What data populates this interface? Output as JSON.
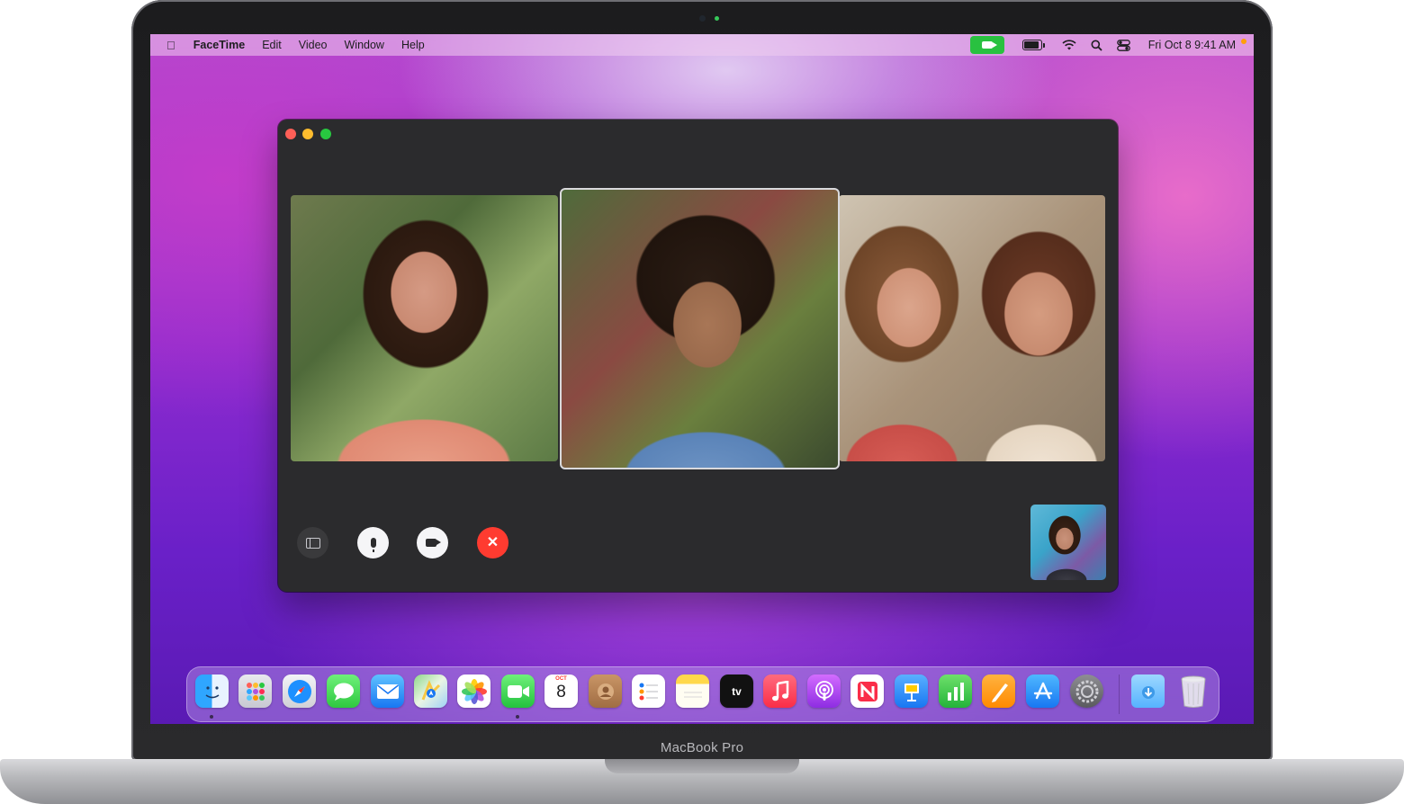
{
  "menubar": {
    "apple_glyph": "",
    "app_name": "FaceTime",
    "menus": [
      "Edit",
      "Video",
      "Window",
      "Help"
    ],
    "clock": "Fri Oct 8  9:41 AM",
    "status_icons": [
      "facetime-recording-icon",
      "battery-icon",
      "wifi-icon",
      "spotlight-icon",
      "control-center-icon"
    ]
  },
  "facetime": {
    "participants": [
      "participant-1",
      "participant-2",
      "participant-3"
    ],
    "controls": {
      "sidebar": "sidebar-icon",
      "mic": "microphone-icon",
      "video": "video-icon",
      "end": "✕"
    }
  },
  "dock": {
    "calendar_month": "OCT",
    "calendar_day": "8",
    "tv_label": "tv",
    "apps": [
      "Finder",
      "Launchpad",
      "Safari",
      "Messages",
      "Mail",
      "Maps",
      "Photos",
      "FaceTime",
      "Calendar",
      "Contacts",
      "Reminders",
      "Notes",
      "TV",
      "Music",
      "Podcasts",
      "News",
      "Keynote",
      "Numbers",
      "Pages",
      "App Store",
      "System Preferences",
      "Downloads",
      "Trash"
    ]
  },
  "laptop": {
    "model_label": "MacBook Pro"
  },
  "colors": {
    "facetime_green": "#29c140",
    "end_call_red": "#ff3b30",
    "window_bg": "#2b2b2d"
  }
}
